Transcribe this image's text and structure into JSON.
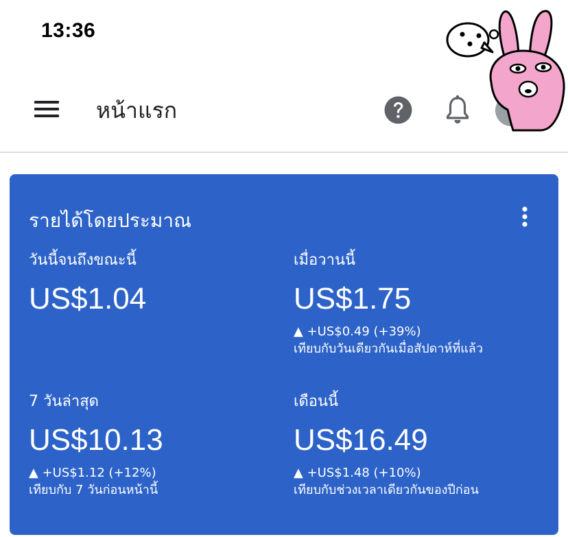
{
  "status_bar": {
    "time": "13:36"
  },
  "app_bar": {
    "title": "หน้าแรก",
    "icons": [
      "menu-icon",
      "help-icon",
      "bell-icon",
      "avatar"
    ]
  },
  "card": {
    "title": "รายได้โดยประมาณ",
    "metrics": [
      {
        "label": "วันนี้จนถึงขณะนี้",
        "value": "US$1.04",
        "change": "",
        "compare": ""
      },
      {
        "label": "เมื่อวานนี้",
        "value": "US$1.75",
        "change": "▲ +US$0.49 (+39%)",
        "compare": "เทียบกับวันเดียวกันเมื่อสัปดาห์ที่แล้ว"
      },
      {
        "label": "7 วันล่าสุด",
        "value": "US$10.13",
        "change": "▲ +US$1.12 (+12%)",
        "compare": "เทียบกับ 7 วันก่อนหน้านี้"
      },
      {
        "label": "เดือนนี้",
        "value": "US$16.49",
        "change": "▲ +US$1.48 (+10%)",
        "compare": "เทียบกับช่วงเวลาเดียวกันของปีก่อน"
      }
    ]
  },
  "colors": {
    "card_background": "#2d63c8",
    "text_dark": "#202124",
    "icon_grey": "#5f6368",
    "divider": "#dadce0"
  }
}
